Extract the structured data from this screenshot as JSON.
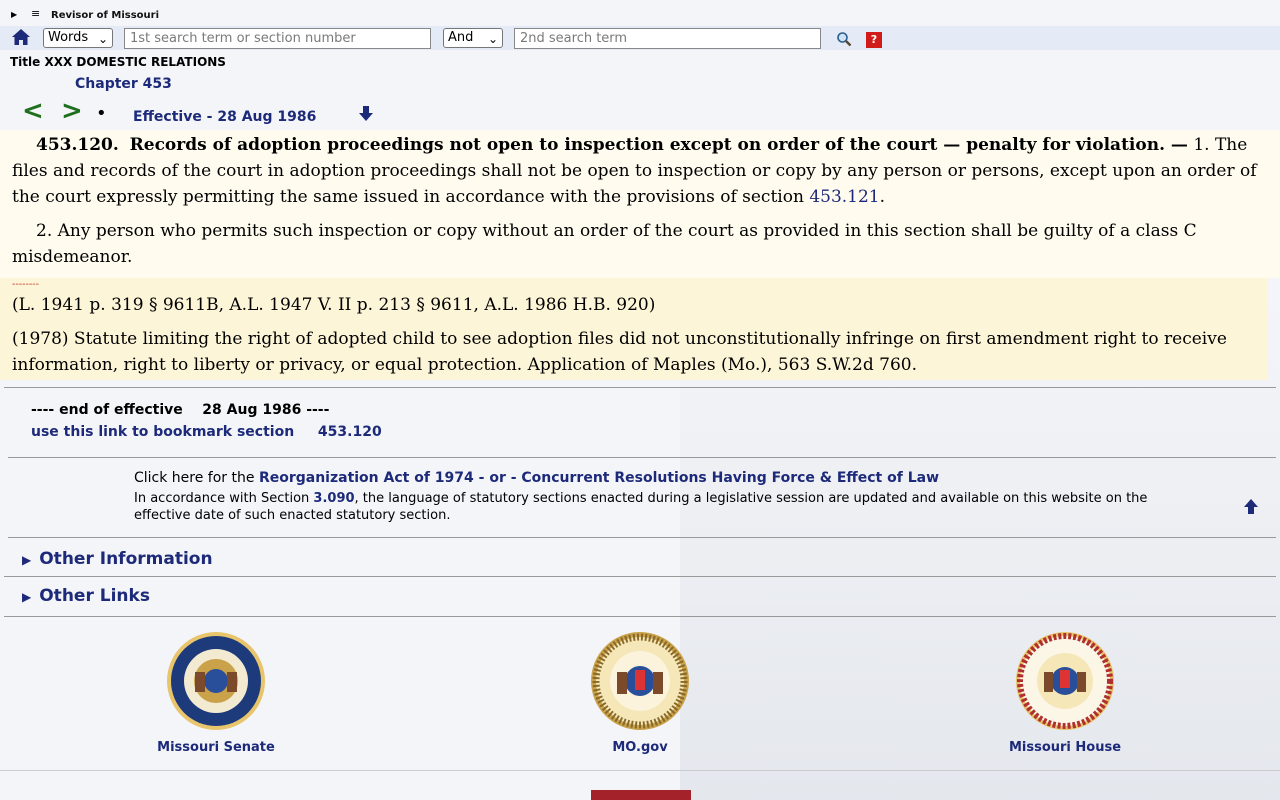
{
  "header": {
    "brand": "Revisor of Missouri",
    "menu_icon": "≡"
  },
  "search": {
    "mode_value": "Words",
    "term1_placeholder": "1st search term or section number",
    "operator_value": "And",
    "term2_placeholder": "2nd search term",
    "help_label": "?"
  },
  "breadcrumb": {
    "title": "Title XXX DOMESTIC RELATIONS",
    "chapter": "Chapter 453"
  },
  "nav": {
    "prev": "<",
    "next": ">",
    "dot": "•",
    "effective": "Effective - 28 Aug 1986"
  },
  "statute": {
    "number": "453.120.",
    "heading": "Records of adoption proceedings not open to inspection except on order of the court — penalty for violation. —",
    "p1_text": " 1.  The files and records of the court in adoption proceedings shall not be open to inspection or copy by any person or persons, except upon an order of the court expressly permitting the same issued in accordance with the provisions of section ",
    "p1_link": "453.121",
    "p1_end": ".",
    "p2": "2.  Any person who permits such inspection or copy without an order of the court as provided in this section shall be guilty of a class C misdemeanor."
  },
  "history": {
    "dashes": "--------",
    "citation": "(L. 1941 p. 319 § 9611B, A.L. 1947 V. II p. 213 § 9611, A.L. 1986 H.B. 920)",
    "annotation": "(1978) Statute limiting the right of adopted child to see adoption files did not unconstitutionally infringe on first amendment right to receive information, right to liberty or privacy, or equal protection. Application of Maples (Mo.), 563 S.W.2d 760."
  },
  "end_section": {
    "end_text": "---- end of effective    28 Aug 1986 ----",
    "bookmark_text": "use this link to bookmark section",
    "bookmark_section": "453.120"
  },
  "reorg": {
    "prefix": "Click here for the ",
    "link": "Reorganization Act of 1974 - or - Concurrent Resolutions Having Force & Effect of Law",
    "note_prefix": "In accordance with Section ",
    "note_section": "3.090",
    "note_suffix": ", the language of statutory sections enacted during a legislative session are updated and available on this website on the effective date of such enacted statutory section."
  },
  "sections": {
    "other_information": "Other Information",
    "other_links": "Other Links"
  },
  "seals": {
    "senate": "Missouri Senate",
    "mogov": "MO.gov",
    "house": "Missouri House"
  },
  "colors": {
    "accent": "#1d2a7a",
    "nav_green": "#1e6f1e",
    "statute_bg": "#fffbef",
    "history_bg": "#fdf5d8",
    "search_bar": "#e4ebf6"
  }
}
